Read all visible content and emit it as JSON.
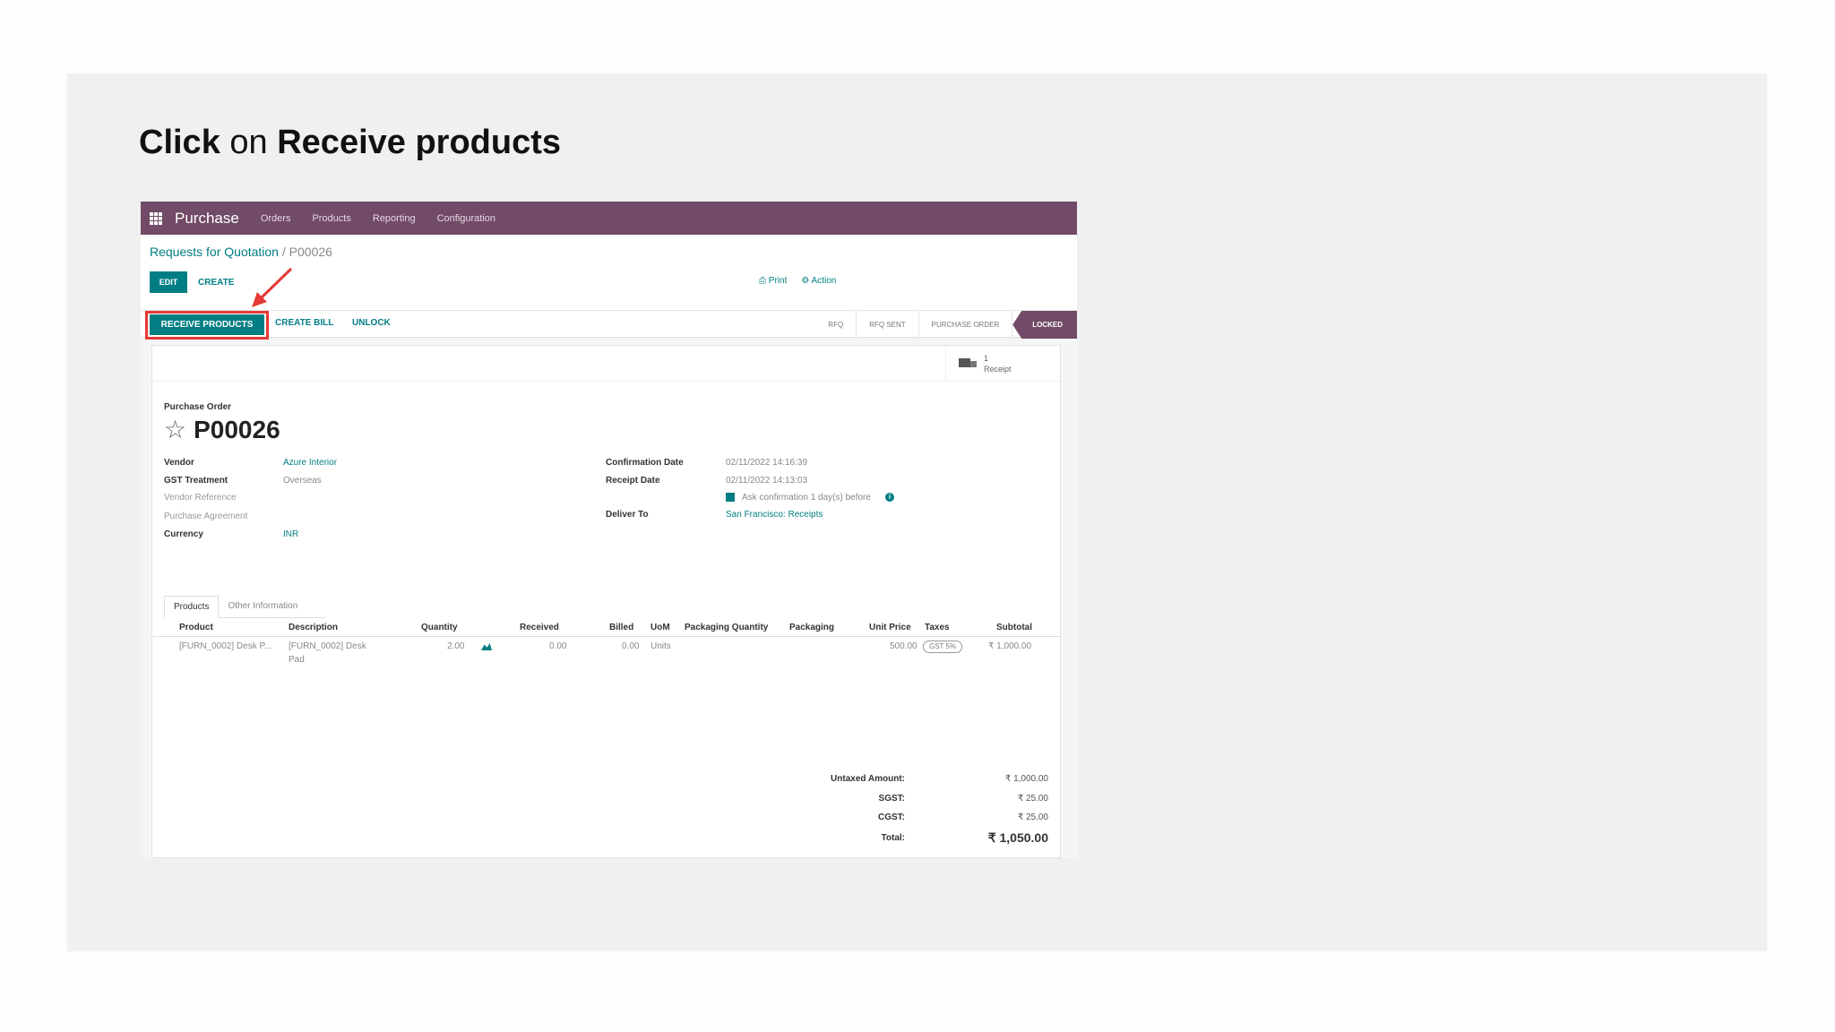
{
  "instruction": {
    "verb": "Click",
    "connector": "on",
    "target": "Receive products"
  },
  "navbar": {
    "app_name": "Purchase",
    "menus": [
      "Orders",
      "Products",
      "Reporting",
      "Configuration"
    ]
  },
  "breadcrumb": {
    "parent": "Requests for Quotation",
    "separator": " / ",
    "current": "P00026"
  },
  "toolbar": {
    "edit_label": "EDIT",
    "create_label": "CREATE",
    "print_label": "Print",
    "action_label": "Action"
  },
  "statusbar": {
    "receive_label": "RECEIVE PRODUCTS",
    "create_bill_label": "CREATE BILL",
    "unlock_label": "UNLOCK",
    "stages": [
      "RFQ",
      "RFQ SENT",
      "PURCHASE ORDER"
    ],
    "active_stage": "LOCKED"
  },
  "smart_button": {
    "count": "1",
    "label": "Receipt"
  },
  "form": {
    "doc_type": "Purchase Order",
    "number": "P00026",
    "left_fields": [
      {
        "label": "Vendor",
        "value": "Azure Interior"
      },
      {
        "label": "GST Treatment",
        "value": "Overseas"
      },
      {
        "label": "Vendor Reference",
        "value": ""
      },
      {
        "label": "Purchase Agreement",
        "value": ""
      },
      {
        "label": "Currency",
        "value": "INR"
      }
    ],
    "right_fields": [
      {
        "label": "Confirmation Date",
        "value": "02/11/2022 14:16:39"
      },
      {
        "label": "Receipt Date",
        "value": "02/11/2022 14:13:03"
      },
      {
        "label": "Deliver To",
        "value": "San Francisco: Receipts"
      }
    ],
    "ask_confirmation": "Ask confirmation  1  day(s) before"
  },
  "tabs": [
    "Products",
    "Other Information"
  ],
  "table": {
    "headers": [
      "Product",
      "Description",
      "Quantity",
      "Received",
      "Billed",
      "UoM",
      "Packaging Quantity",
      "Packaging",
      "Unit Price",
      "Taxes",
      "Subtotal"
    ],
    "rows": [
      {
        "product": "[FURN_0002] Desk P...",
        "description_line1": "[FURN_0002] Desk",
        "description_line2": "Pad",
        "quantity": "2.00",
        "received": "0.00",
        "billed": "0.00",
        "uom": "Units",
        "unit_price": "500.00",
        "taxes": "GST 5%",
        "subtotal": "₹ 1,000.00"
      }
    ]
  },
  "totals": {
    "untaxed_label": "Untaxed Amount:",
    "untaxed_value": "₹ 1,000.00",
    "sgst_label": "SGST:",
    "sgst_value": "₹ 25.00",
    "cgst_label": "CGST:",
    "cgst_value": "₹ 25.00",
    "total_label": "Total:",
    "total_value": "₹ 1,050.00"
  },
  "colors": {
    "brand": "#714b67",
    "accent": "#017e84",
    "highlight": "#e53935"
  }
}
